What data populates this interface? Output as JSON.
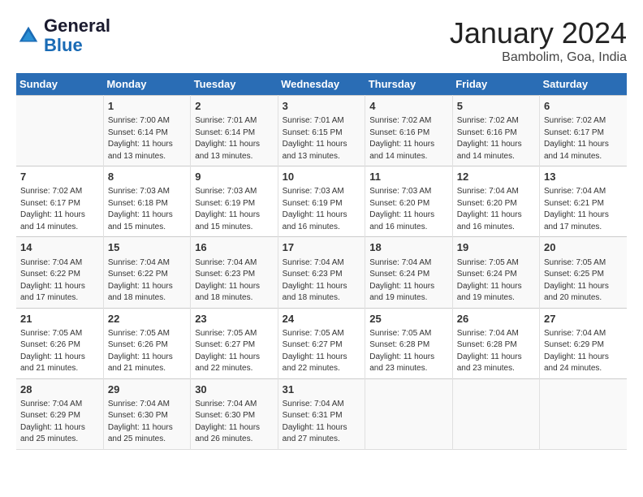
{
  "header": {
    "logo_general": "General",
    "logo_blue": "Blue",
    "month": "January 2024",
    "location": "Bambolim, Goa, India"
  },
  "weekdays": [
    "Sunday",
    "Monday",
    "Tuesday",
    "Wednesday",
    "Thursday",
    "Friday",
    "Saturday"
  ],
  "weeks": [
    [
      {
        "day": "",
        "content": ""
      },
      {
        "day": "1",
        "content": "Sunrise: 7:00 AM\nSunset: 6:14 PM\nDaylight: 11 hours\nand 13 minutes."
      },
      {
        "day": "2",
        "content": "Sunrise: 7:01 AM\nSunset: 6:14 PM\nDaylight: 11 hours\nand 13 minutes."
      },
      {
        "day": "3",
        "content": "Sunrise: 7:01 AM\nSunset: 6:15 PM\nDaylight: 11 hours\nand 13 minutes."
      },
      {
        "day": "4",
        "content": "Sunrise: 7:02 AM\nSunset: 6:16 PM\nDaylight: 11 hours\nand 14 minutes."
      },
      {
        "day": "5",
        "content": "Sunrise: 7:02 AM\nSunset: 6:16 PM\nDaylight: 11 hours\nand 14 minutes."
      },
      {
        "day": "6",
        "content": "Sunrise: 7:02 AM\nSunset: 6:17 PM\nDaylight: 11 hours\nand 14 minutes."
      }
    ],
    [
      {
        "day": "7",
        "content": "Sunrise: 7:02 AM\nSunset: 6:17 PM\nDaylight: 11 hours\nand 14 minutes."
      },
      {
        "day": "8",
        "content": "Sunrise: 7:03 AM\nSunset: 6:18 PM\nDaylight: 11 hours\nand 15 minutes."
      },
      {
        "day": "9",
        "content": "Sunrise: 7:03 AM\nSunset: 6:19 PM\nDaylight: 11 hours\nand 15 minutes."
      },
      {
        "day": "10",
        "content": "Sunrise: 7:03 AM\nSunset: 6:19 PM\nDaylight: 11 hours\nand 16 minutes."
      },
      {
        "day": "11",
        "content": "Sunrise: 7:03 AM\nSunset: 6:20 PM\nDaylight: 11 hours\nand 16 minutes."
      },
      {
        "day": "12",
        "content": "Sunrise: 7:04 AM\nSunset: 6:20 PM\nDaylight: 11 hours\nand 16 minutes."
      },
      {
        "day": "13",
        "content": "Sunrise: 7:04 AM\nSunset: 6:21 PM\nDaylight: 11 hours\nand 17 minutes."
      }
    ],
    [
      {
        "day": "14",
        "content": "Sunrise: 7:04 AM\nSunset: 6:22 PM\nDaylight: 11 hours\nand 17 minutes."
      },
      {
        "day": "15",
        "content": "Sunrise: 7:04 AM\nSunset: 6:22 PM\nDaylight: 11 hours\nand 18 minutes."
      },
      {
        "day": "16",
        "content": "Sunrise: 7:04 AM\nSunset: 6:23 PM\nDaylight: 11 hours\nand 18 minutes."
      },
      {
        "day": "17",
        "content": "Sunrise: 7:04 AM\nSunset: 6:23 PM\nDaylight: 11 hours\nand 18 minutes."
      },
      {
        "day": "18",
        "content": "Sunrise: 7:04 AM\nSunset: 6:24 PM\nDaylight: 11 hours\nand 19 minutes."
      },
      {
        "day": "19",
        "content": "Sunrise: 7:05 AM\nSunset: 6:24 PM\nDaylight: 11 hours\nand 19 minutes."
      },
      {
        "day": "20",
        "content": "Sunrise: 7:05 AM\nSunset: 6:25 PM\nDaylight: 11 hours\nand 20 minutes."
      }
    ],
    [
      {
        "day": "21",
        "content": "Sunrise: 7:05 AM\nSunset: 6:26 PM\nDaylight: 11 hours\nand 21 minutes."
      },
      {
        "day": "22",
        "content": "Sunrise: 7:05 AM\nSunset: 6:26 PM\nDaylight: 11 hours\nand 21 minutes."
      },
      {
        "day": "23",
        "content": "Sunrise: 7:05 AM\nSunset: 6:27 PM\nDaylight: 11 hours\nand 22 minutes."
      },
      {
        "day": "24",
        "content": "Sunrise: 7:05 AM\nSunset: 6:27 PM\nDaylight: 11 hours\nand 22 minutes."
      },
      {
        "day": "25",
        "content": "Sunrise: 7:05 AM\nSunset: 6:28 PM\nDaylight: 11 hours\nand 23 minutes."
      },
      {
        "day": "26",
        "content": "Sunrise: 7:04 AM\nSunset: 6:28 PM\nDaylight: 11 hours\nand 23 minutes."
      },
      {
        "day": "27",
        "content": "Sunrise: 7:04 AM\nSunset: 6:29 PM\nDaylight: 11 hours\nand 24 minutes."
      }
    ],
    [
      {
        "day": "28",
        "content": "Sunrise: 7:04 AM\nSunset: 6:29 PM\nDaylight: 11 hours\nand 25 minutes."
      },
      {
        "day": "29",
        "content": "Sunrise: 7:04 AM\nSunset: 6:30 PM\nDaylight: 11 hours\nand 25 minutes."
      },
      {
        "day": "30",
        "content": "Sunrise: 7:04 AM\nSunset: 6:30 PM\nDaylight: 11 hours\nand 26 minutes."
      },
      {
        "day": "31",
        "content": "Sunrise: 7:04 AM\nSunset: 6:31 PM\nDaylight: 11 hours\nand 27 minutes."
      },
      {
        "day": "",
        "content": ""
      },
      {
        "day": "",
        "content": ""
      },
      {
        "day": "",
        "content": ""
      }
    ]
  ]
}
